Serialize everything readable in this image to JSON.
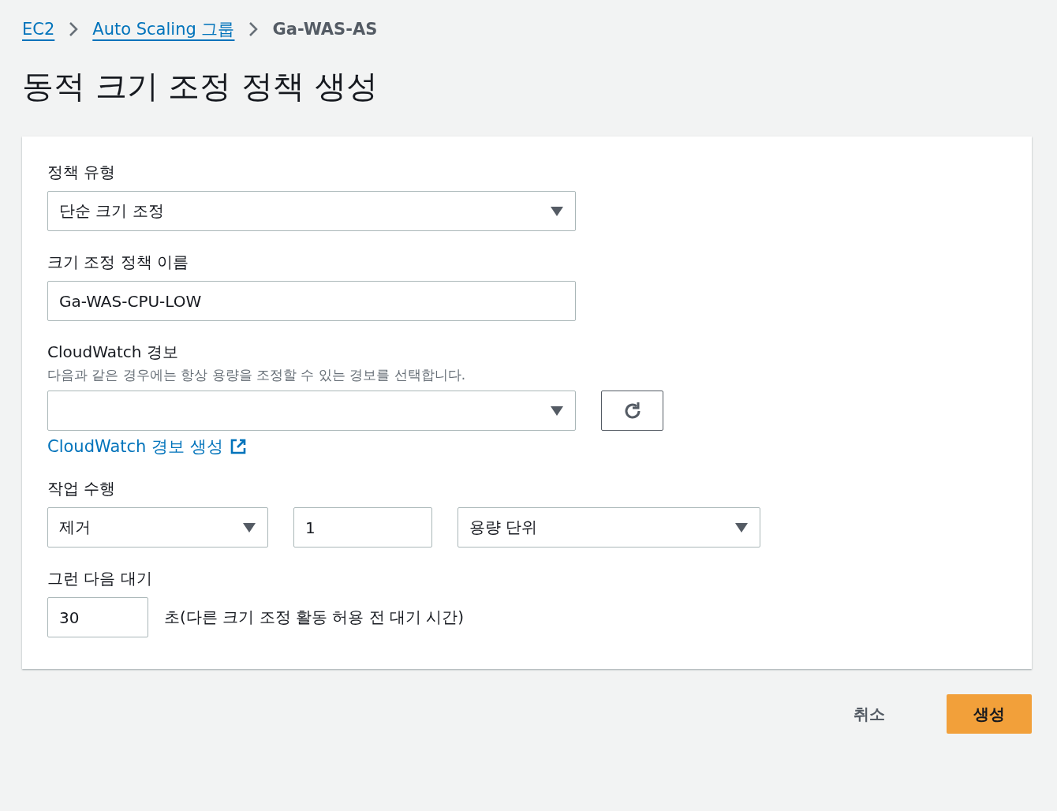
{
  "breadcrumbs": [
    {
      "label": "EC2",
      "link": true
    },
    {
      "label": "Auto Scaling 그룹",
      "link": true
    },
    {
      "label": "Ga-WAS-AS",
      "link": false
    }
  ],
  "title": "동적 크기 조정 정책 생성",
  "form": {
    "policy_type": {
      "label": "정책 유형",
      "value": "단순 크기 조정"
    },
    "policy_name": {
      "label": "크기 조정 정책 이름",
      "value": "Ga-WAS-CPU-LOW"
    },
    "alarm": {
      "label": "CloudWatch 경보",
      "description": "다음과 같은 경우에는 항상 용량을 조정할 수 있는 경보를 선택합니다.",
      "create_link": "CloudWatch 경보 생성"
    },
    "action": {
      "label": "작업 수행",
      "operation": "제거",
      "amount": "1",
      "unit": "용량 단위"
    },
    "wait": {
      "label": "그런 다음 대기",
      "value": "30",
      "suffix": "초(다른 크기 조정 활동 허용 전 대기 시간)"
    }
  },
  "buttons": [
    {
      "label": "취소",
      "kind": "secondary"
    },
    {
      "label": "생성",
      "kind": "primary"
    }
  ]
}
